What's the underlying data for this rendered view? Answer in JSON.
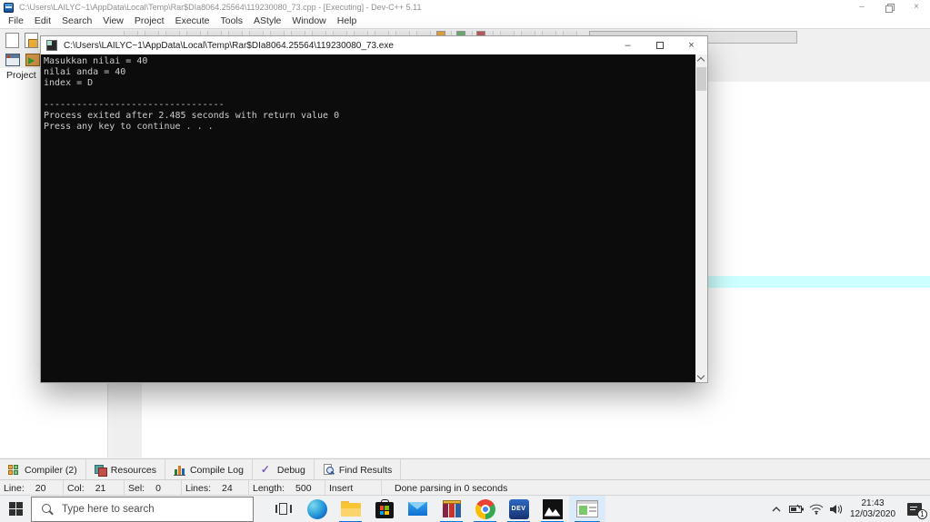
{
  "main_window": {
    "title": "C:\\Users\\LAILYC~1\\AppData\\Local\\Temp\\Rar$DIa8064.25564\\119230080_73.cpp - [Executing] - Dev-C++ 5.11",
    "controls": {
      "minimize": "–",
      "close": "×"
    },
    "menu": [
      "File",
      "Edit",
      "Search",
      "View",
      "Project",
      "Execute",
      "Tools",
      "AStyle",
      "Window",
      "Help"
    ],
    "left_panel": {
      "tab": "Project"
    },
    "bottom_tabs": [
      {
        "label": "Compiler (2)"
      },
      {
        "label": "Resources"
      },
      {
        "label": "Compile Log"
      },
      {
        "label": "Debug"
      },
      {
        "label": "Find Results"
      }
    ],
    "status_bar": {
      "line_label": "Line:",
      "line_value": "20",
      "col_label": "Col:",
      "col_value": "21",
      "sel_label": "Sel:",
      "sel_value": "0",
      "lines_label": "Lines:",
      "lines_value": "24",
      "length_label": "Length:",
      "length_value": "500",
      "mode": "Insert",
      "message": "Done parsing in 0 seconds"
    }
  },
  "console_window": {
    "title": "C:\\Users\\LAILYC~1\\AppData\\Local\\Temp\\Rar$DIa8064.25564\\119230080_73.exe",
    "controls": {
      "minimize": "–",
      "close": "×"
    },
    "lines": [
      "Masukkan nilai = 40",
      "nilai anda = 40",
      "index = D",
      "",
      "---------------------------------",
      "Process exited after 2.485 seconds with return value 0",
      "Press any key to continue . . ."
    ]
  },
  "taskbar": {
    "search_placeholder": "Type here to search",
    "clock": {
      "time": "21:43",
      "date": "12/03/2020"
    },
    "notification_badge": "1",
    "app_icons": [
      "task-view",
      "edge",
      "file-explorer",
      "store",
      "mail",
      "winrar",
      "chrome",
      "dev-cpp",
      "photos",
      "active-window"
    ]
  },
  "colors": {
    "accent_blue": "#0078d7",
    "console_bg": "#0c0c0c",
    "console_text": "#cccccc",
    "current_line_highlight": "#ccffff"
  }
}
